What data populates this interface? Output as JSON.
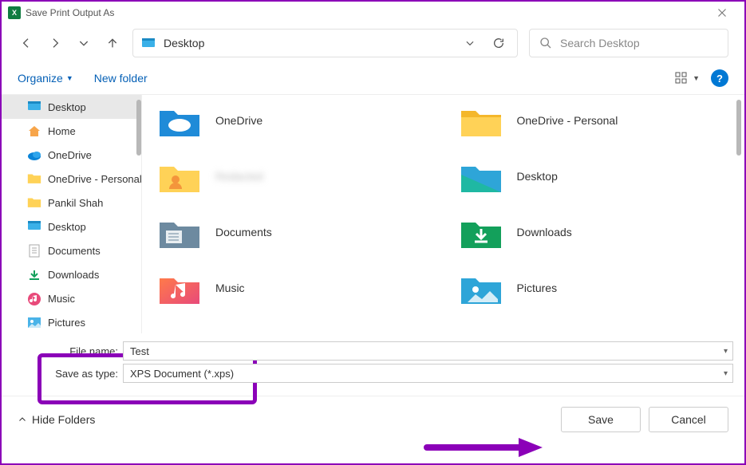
{
  "window": {
    "title": "Save Print Output As"
  },
  "nav": {
    "location": "Desktop",
    "search_placeholder": "Search Desktop"
  },
  "toolbar": {
    "organize": "Organize",
    "newfolder": "New folder"
  },
  "sidebar": {
    "items": [
      {
        "label": "Desktop",
        "icon": "desktop"
      },
      {
        "label": "Home",
        "icon": "home"
      },
      {
        "label": "OneDrive",
        "icon": "onedrive"
      },
      {
        "label": "OneDrive - Personal",
        "icon": "folder-yellow"
      },
      {
        "label": "Pankil Shah",
        "icon": "folder-yellow"
      },
      {
        "label": "Desktop",
        "icon": "desktop"
      },
      {
        "label": "Documents",
        "icon": "documents"
      },
      {
        "label": "Downloads",
        "icon": "downloads"
      },
      {
        "label": "Music",
        "icon": "music"
      },
      {
        "label": "Pictures",
        "icon": "pictures"
      }
    ]
  },
  "content": {
    "items": [
      {
        "label": "OneDrive",
        "icon": "onedrive-folder"
      },
      {
        "label": "OneDrive - Personal",
        "icon": "folder-yellow"
      },
      {
        "label": "Redacted",
        "icon": "user-folder",
        "blur": true
      },
      {
        "label": "Desktop",
        "icon": "desktop-folder"
      },
      {
        "label": "Documents",
        "icon": "documents-folder"
      },
      {
        "label": "Downloads",
        "icon": "downloads-folder"
      },
      {
        "label": "Music",
        "icon": "music-folder"
      },
      {
        "label": "Pictures",
        "icon": "pictures-folder"
      }
    ]
  },
  "fields": {
    "filename_label": "File name:",
    "filename_value": "Test",
    "savetype_label": "Save as type:",
    "savetype_value": "XPS Document (*.xps)"
  },
  "footer": {
    "hidefolders": "Hide Folders",
    "save": "Save",
    "cancel": "Cancel"
  }
}
